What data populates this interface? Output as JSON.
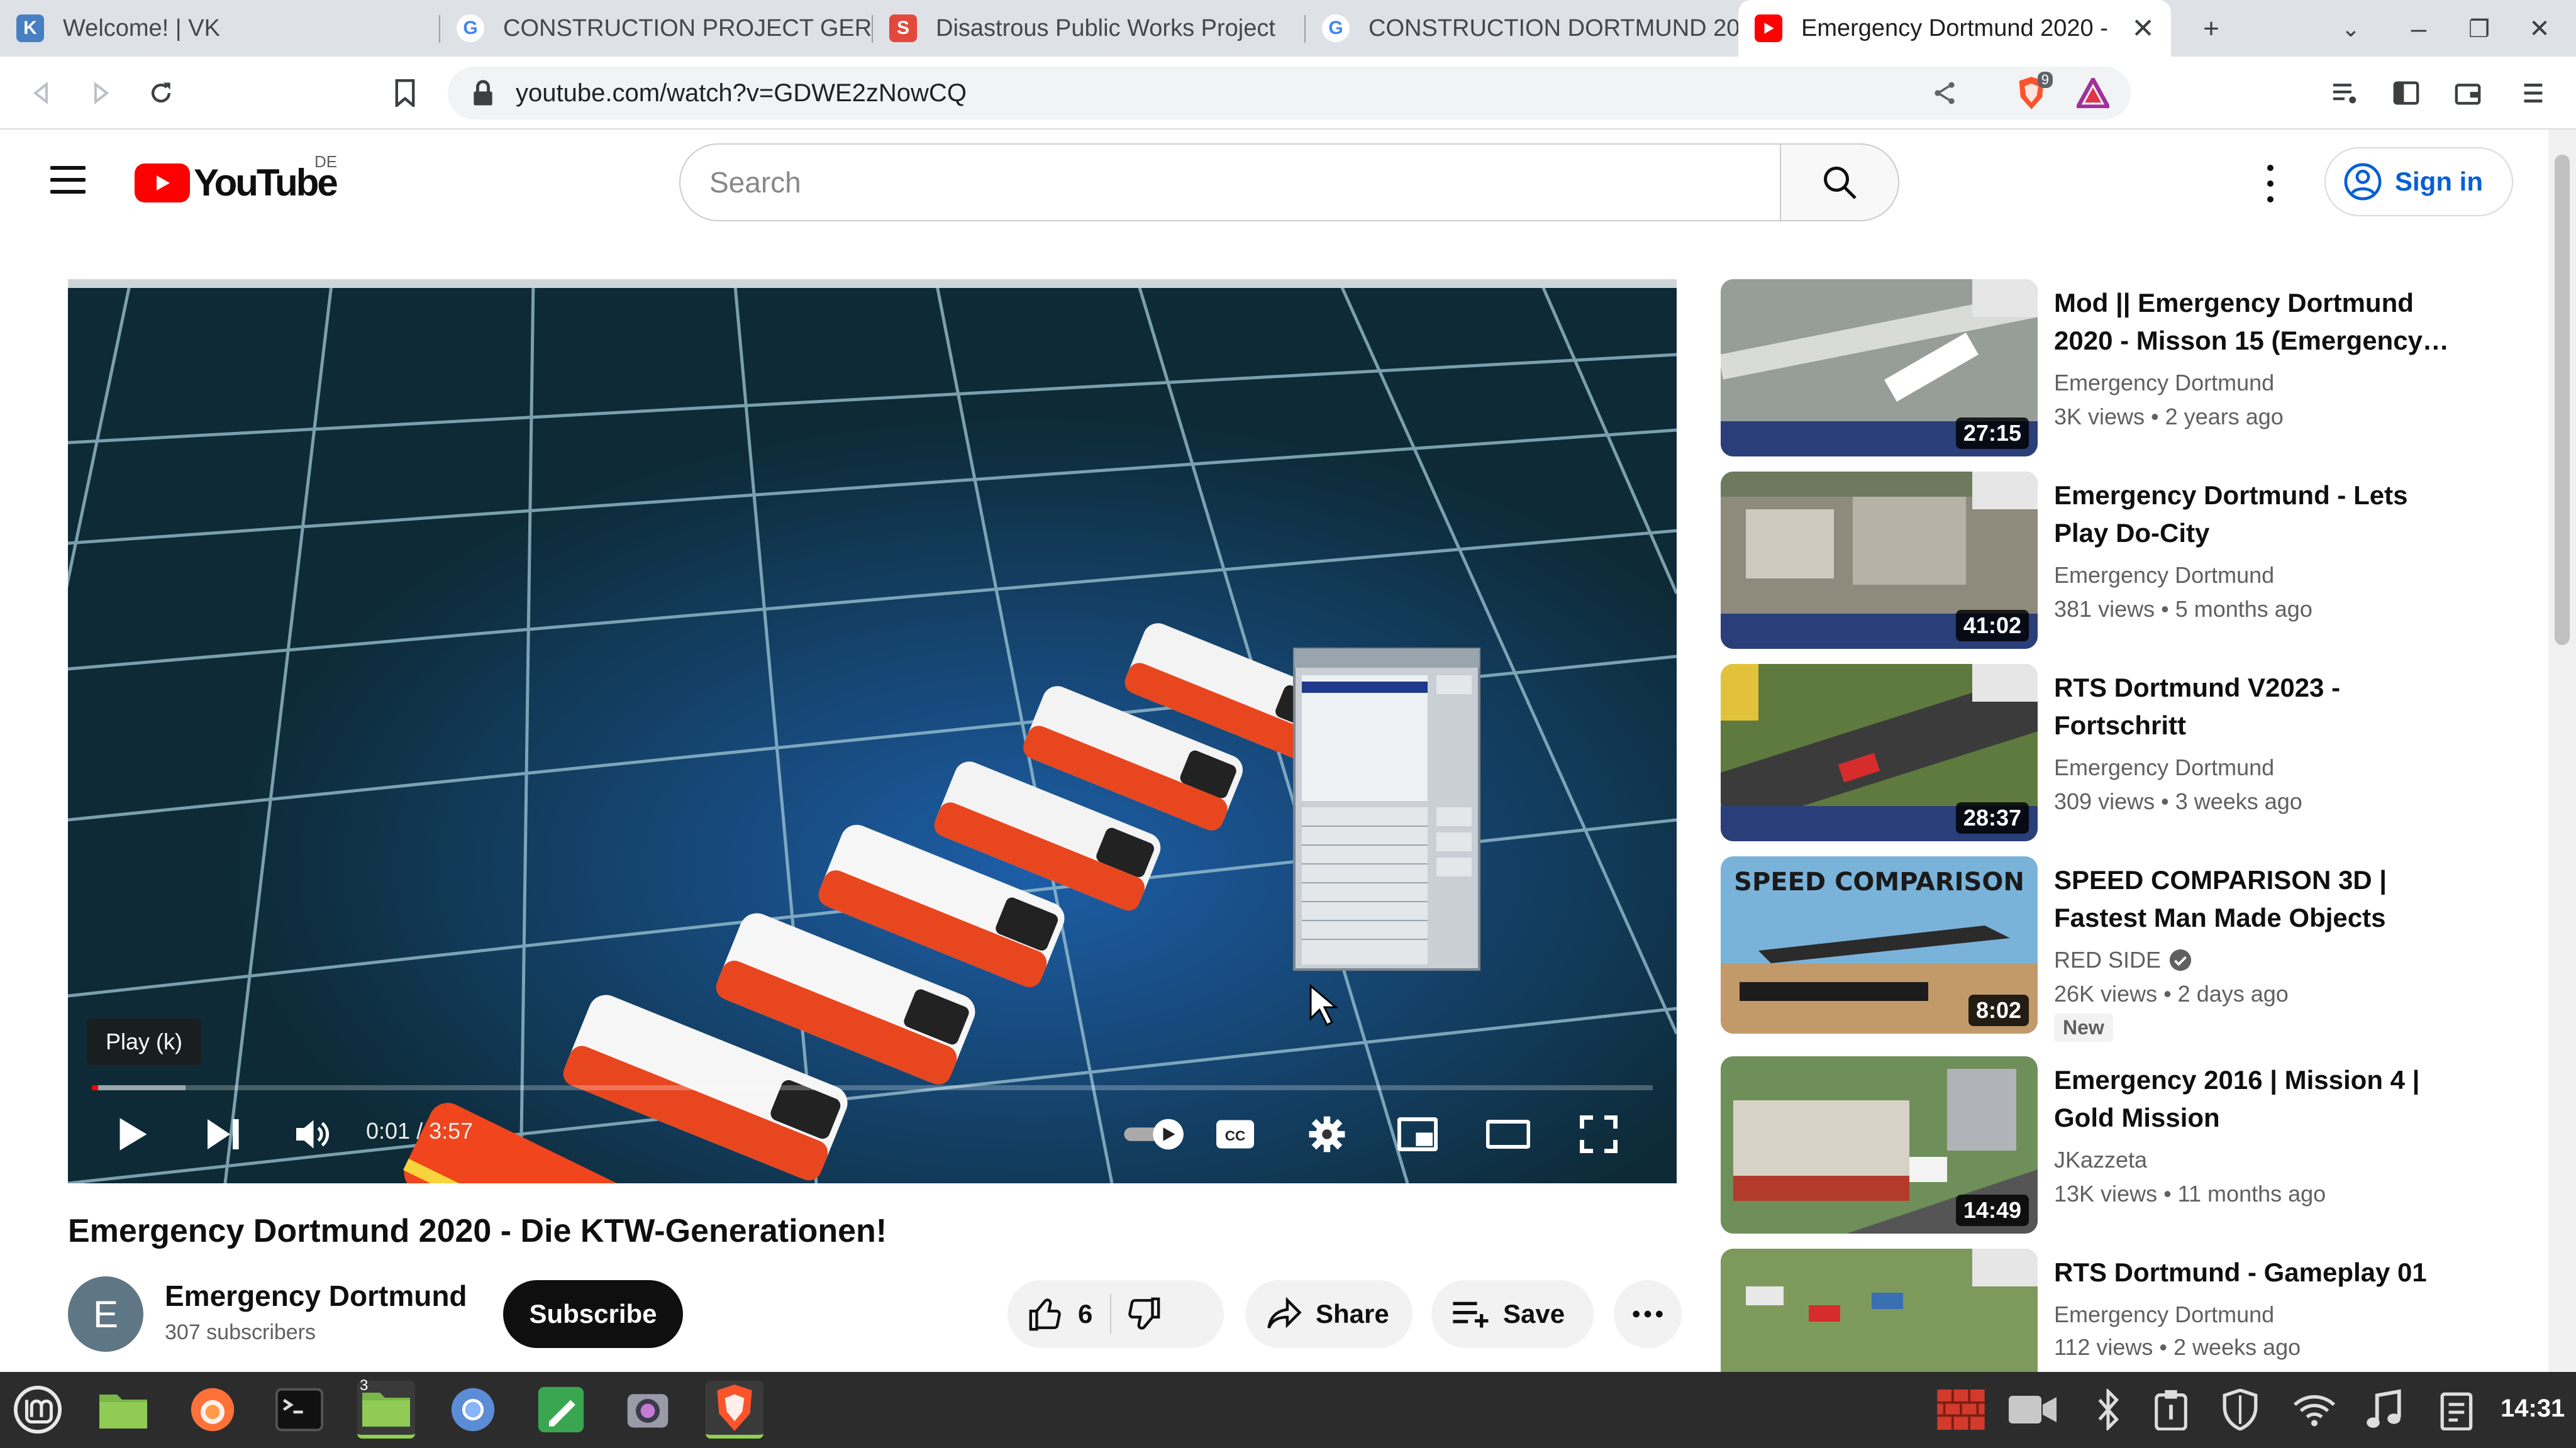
{
  "browser": {
    "tabs": [
      {
        "title": "Welcome! | VK",
        "icon": "vk-icon",
        "color": "#4680c2"
      },
      {
        "title": "CONSTRUCTION PROJECT GERM",
        "icon": "google-icon",
        "color": "#4285f4"
      },
      {
        "title": "Disastrous Public Works Project",
        "icon": "site-s-icon",
        "color": "#e2483b"
      },
      {
        "title": "CONSTRUCTION DORTMUND 20",
        "icon": "google-icon",
        "color": "#4285f4"
      },
      {
        "title": "Emergency Dortmund 2020 -",
        "icon": "youtube-icon",
        "color": "#ff0000"
      }
    ],
    "url": "youtube.com/watch?v=GDWE2zNowCQ",
    "extension_badge": "9"
  },
  "youtube": {
    "logo": "YouTube",
    "country": "DE",
    "search_placeholder": "Search",
    "sign_in": "Sign in"
  },
  "player": {
    "tooltip": "Play (k)",
    "time": "0:01 / 3:57",
    "progress_fraction": 0.003,
    "buffered_fraction": 0.06
  },
  "video": {
    "title": "Emergency Dortmund 2020 - Die KTW-Generationen!",
    "channel": "Emergency Dortmund",
    "channel_initial": "E",
    "subscribers": "307 subscribers",
    "subscribe_label": "Subscribe",
    "likes": "6",
    "share_label": "Share",
    "save_label": "Save"
  },
  "recommendations": [
    {
      "title": "Mod || Emergency Dortmund 2020 - Misson 15 (Emergency…",
      "channel": "Emergency Dortmund",
      "meta": "3K views  • 2 years ago",
      "duration": "27:15",
      "verified": false,
      "new": false
    },
    {
      "title": "Emergency Dortmund - Lets Play Do-City",
      "channel": "Emergency Dortmund",
      "meta": "381 views  • 5 months ago",
      "duration": "41:02",
      "verified": false,
      "new": false
    },
    {
      "title": "RTS Dortmund V2023 - Fortschritt",
      "channel": "Emergency Dortmund",
      "meta": "309 views  • 3 weeks ago",
      "duration": "28:37",
      "verified": false,
      "new": false
    },
    {
      "title": "SPEED COMPARISON 3D | Fastest Man Made Objects",
      "channel": "RED SIDE",
      "meta": "26K views  • 2 days ago",
      "duration": "8:02",
      "verified": true,
      "new": true,
      "badge": "New",
      "thumb_text": "SPEED COMPARISON"
    },
    {
      "title": "Emergency 2016 | Mission 4 | Gold Mission",
      "channel": "JKazzeta",
      "meta": "13K views  • 11 months ago",
      "duration": "14:49",
      "verified": false,
      "new": false
    },
    {
      "title": "RTS Dortmund - Gameplay 01",
      "channel": "Emergency Dortmund",
      "meta": "112 views  • 2 weeks ago",
      "duration": "",
      "verified": false,
      "new": false
    }
  ],
  "taskbar": {
    "clock": "14:31",
    "workspace_badge": "3"
  },
  "colors": {
    "accent_blue": "#065fd4",
    "youtube_red": "#ff0000",
    "taskbar_bg": "#2c2c2c"
  }
}
